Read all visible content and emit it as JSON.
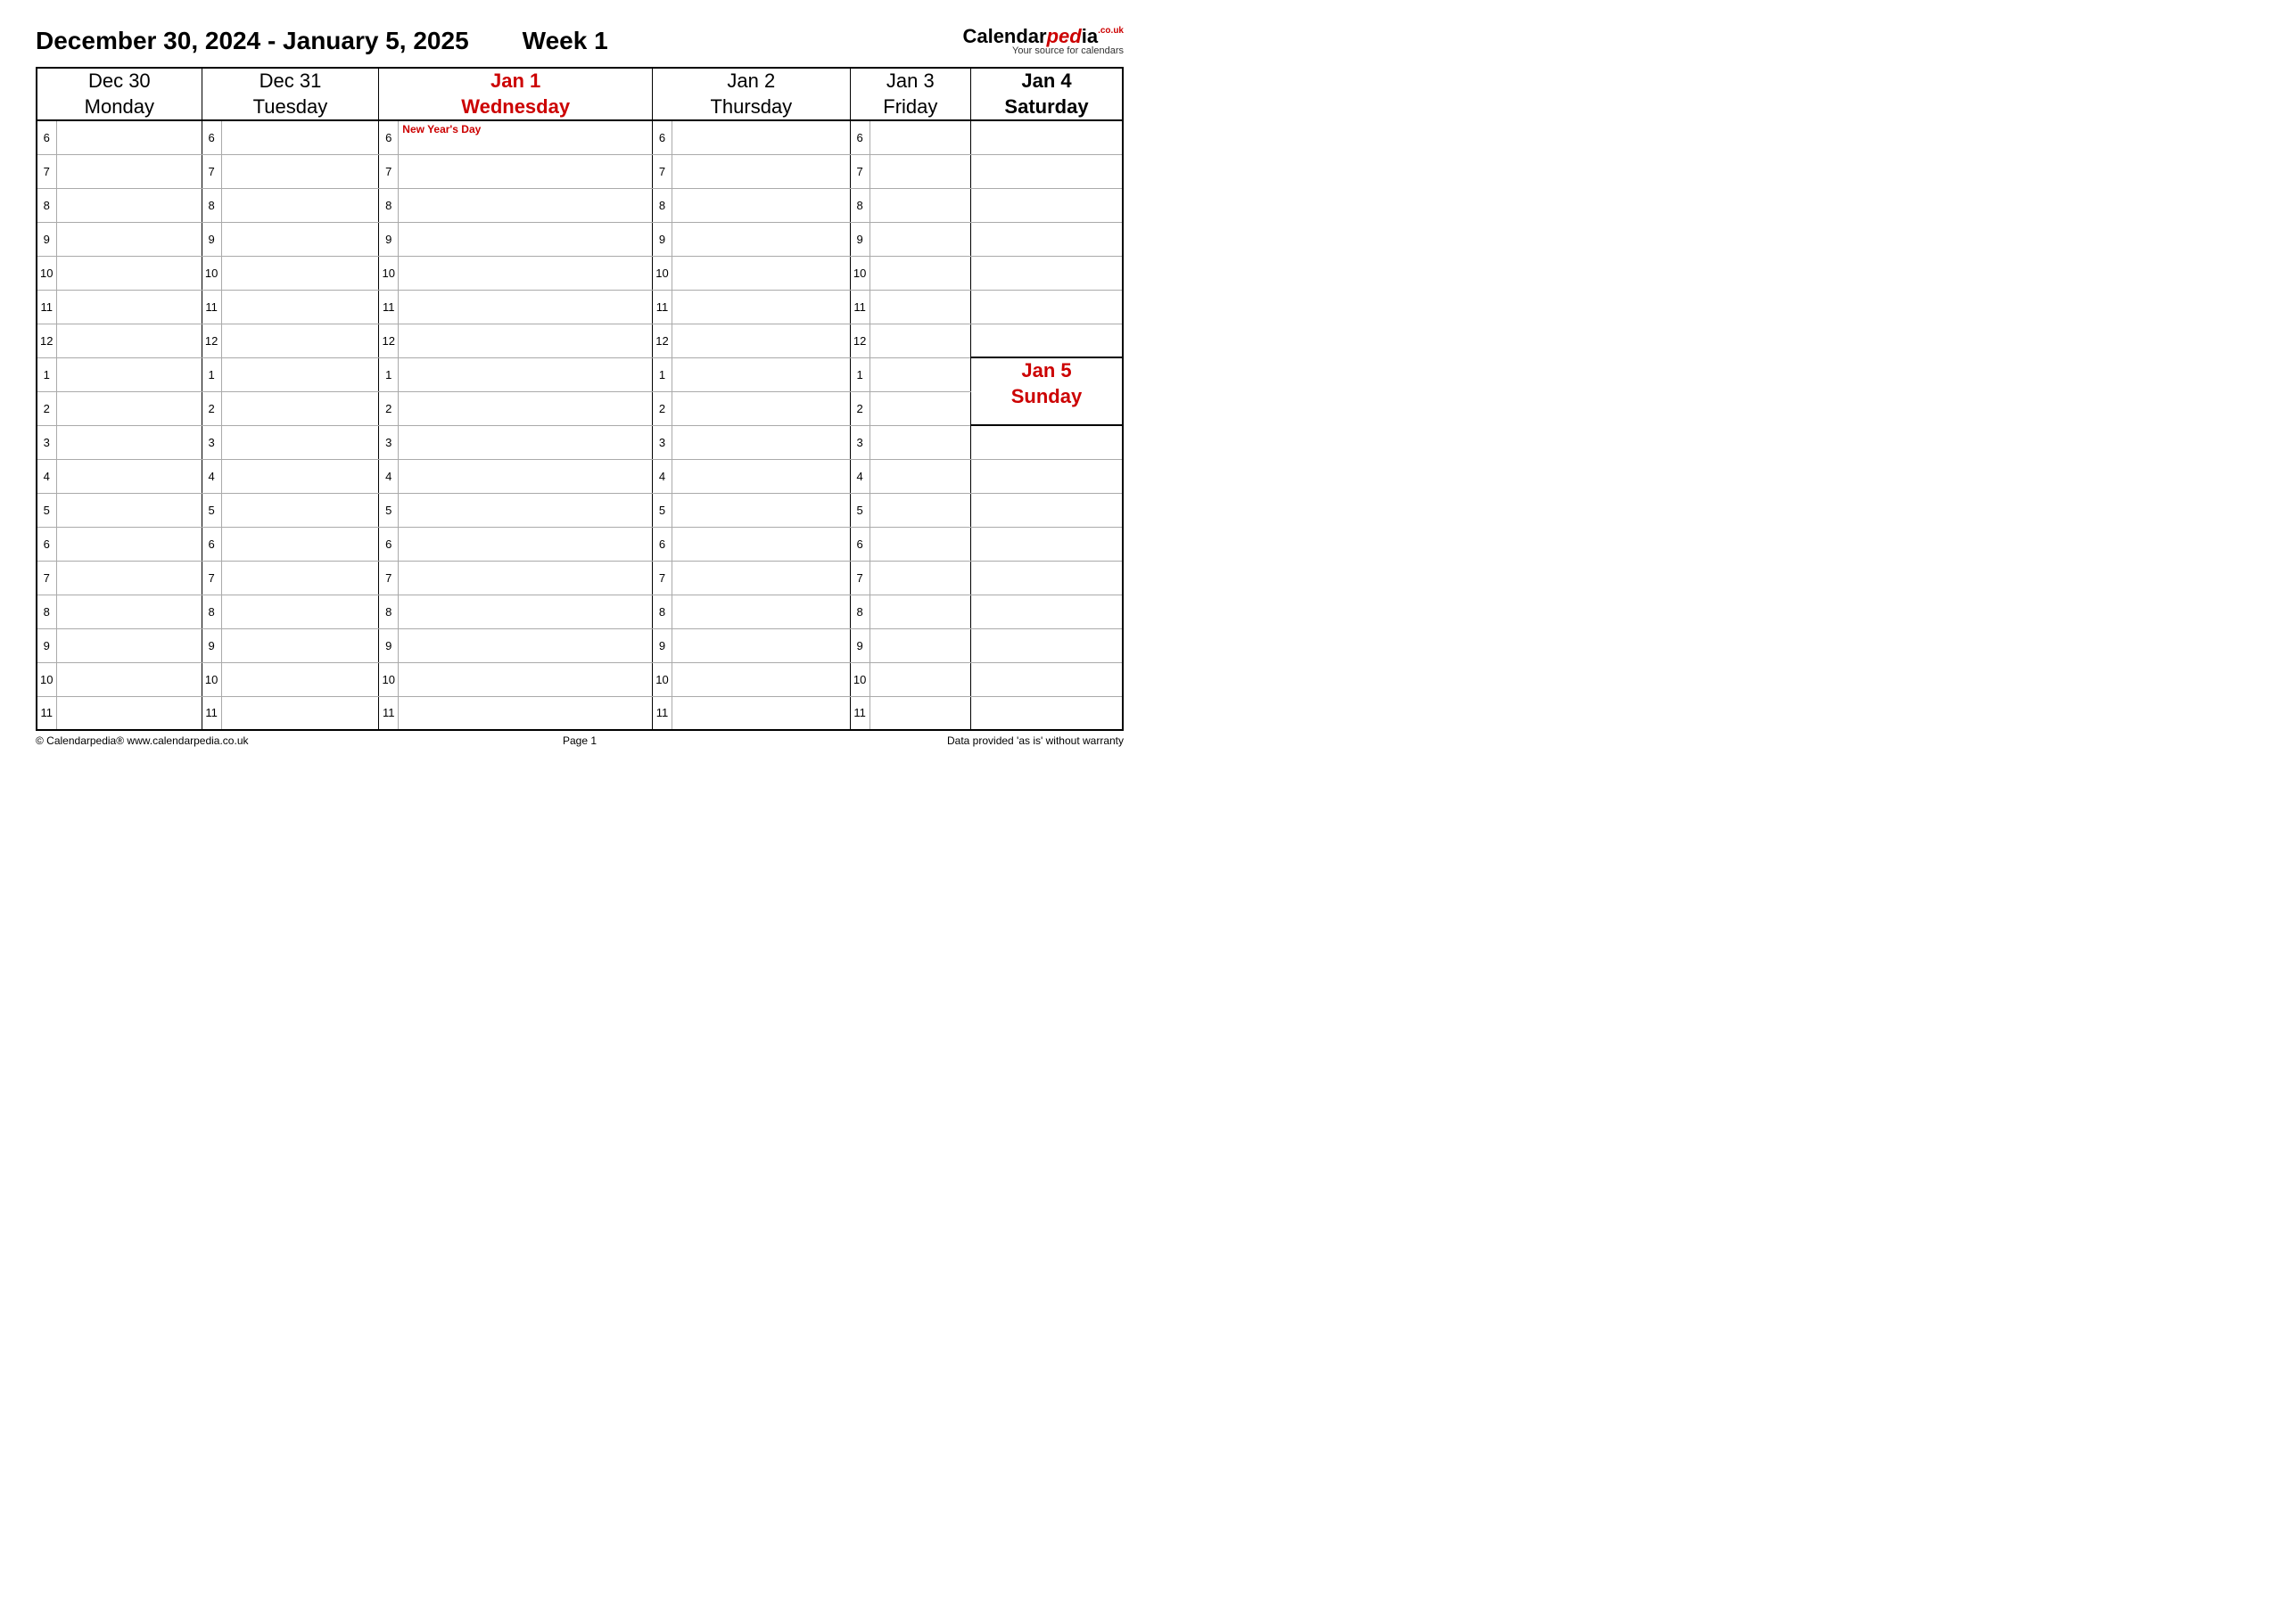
{
  "header": {
    "date_range": "December 30, 2024 - January 5, 2025",
    "week_label": "Week 1"
  },
  "logo": {
    "part1": "Calendar",
    "part2": "ped",
    "part3": "ia",
    "couk": ".co.uk",
    "tagline": "Your source for calendars"
  },
  "days": [
    {
      "date": "Dec 30",
      "weekday": "Monday",
      "red": false,
      "bold": false,
      "holiday": ""
    },
    {
      "date": "Dec 31",
      "weekday": "Tuesday",
      "red": false,
      "bold": false,
      "holiday": ""
    },
    {
      "date": "Jan 1",
      "weekday": "Wednesday",
      "red": true,
      "bold": true,
      "holiday": "New Year's Day"
    },
    {
      "date": "Jan 2",
      "weekday": "Thursday",
      "red": false,
      "bold": false,
      "holiday": ""
    },
    {
      "date": "Jan 3",
      "weekday": "Friday",
      "red": false,
      "bold": false,
      "holiday": ""
    }
  ],
  "saturday": {
    "date": "Jan 4",
    "weekday": "Saturday"
  },
  "sunday": {
    "date": "Jan 5",
    "weekday": "Sunday"
  },
  "hours": [
    "6",
    "7",
    "8",
    "9",
    "10",
    "11",
    "12",
    "1",
    "2",
    "3",
    "4",
    "5",
    "6",
    "7",
    "8",
    "9",
    "10",
    "11"
  ],
  "footer": {
    "left": "© Calendarpedia®   www.calendarpedia.co.uk",
    "center": "Page 1",
    "right": "Data provided 'as is' without warranty"
  }
}
